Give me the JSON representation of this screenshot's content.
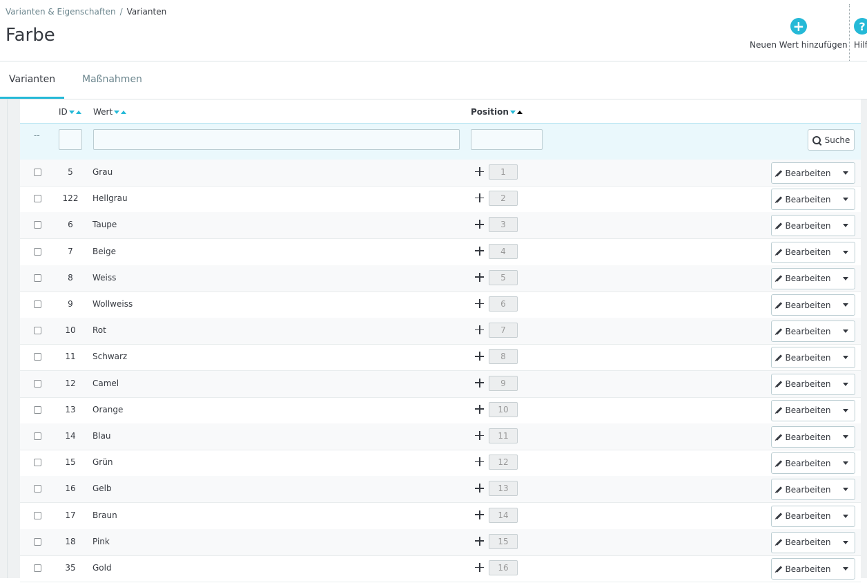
{
  "breadcrumb": {
    "parent": "Varianten & Eigenschaften",
    "separator": "/",
    "current": "Varianten"
  },
  "page_title": "Farbe",
  "toolbar": {
    "add_label": "Neuen Wert hinzufügen",
    "help_label": "Hilf"
  },
  "tabs": [
    {
      "label": "Varianten"
    },
    {
      "label": "Maßnahmen"
    }
  ],
  "table": {
    "headers": {
      "id": "ID",
      "value": "Wert",
      "position": "Position"
    },
    "filter_dash": "--",
    "search_label": "Suche",
    "edit_label": "Bearbeiten",
    "rows": [
      {
        "id": "5",
        "name": "Grau",
        "position": "1"
      },
      {
        "id": "122",
        "name": "Hellgrau",
        "position": "2"
      },
      {
        "id": "6",
        "name": "Taupe",
        "position": "3"
      },
      {
        "id": "7",
        "name": "Beige",
        "position": "4"
      },
      {
        "id": "8",
        "name": "Weiss",
        "position": "5"
      },
      {
        "id": "9",
        "name": "Wollweiss",
        "position": "6"
      },
      {
        "id": "10",
        "name": "Rot",
        "position": "7"
      },
      {
        "id": "11",
        "name": "Schwarz",
        "position": "8"
      },
      {
        "id": "12",
        "name": "Camel",
        "position": "9"
      },
      {
        "id": "13",
        "name": "Orange",
        "position": "10"
      },
      {
        "id": "14",
        "name": "Blau",
        "position": "11"
      },
      {
        "id": "15",
        "name": "Grün",
        "position": "12"
      },
      {
        "id": "16",
        "name": "Gelb",
        "position": "13"
      },
      {
        "id": "17",
        "name": "Braun",
        "position": "14"
      },
      {
        "id": "18",
        "name": "Pink",
        "position": "15"
      },
      {
        "id": "35",
        "name": "Gold",
        "position": "16"
      }
    ]
  },
  "colors": {
    "accent": "#25b9d7",
    "text": "#363a41",
    "muted": "#6c868e",
    "filter_bg": "#eaf8fc"
  },
  "icons": {
    "add": "plus-circle-icon",
    "help": "question-circle-icon",
    "search": "search-icon",
    "edit": "pencil-icon",
    "move": "move-icon",
    "caret": "caret-down-icon"
  }
}
